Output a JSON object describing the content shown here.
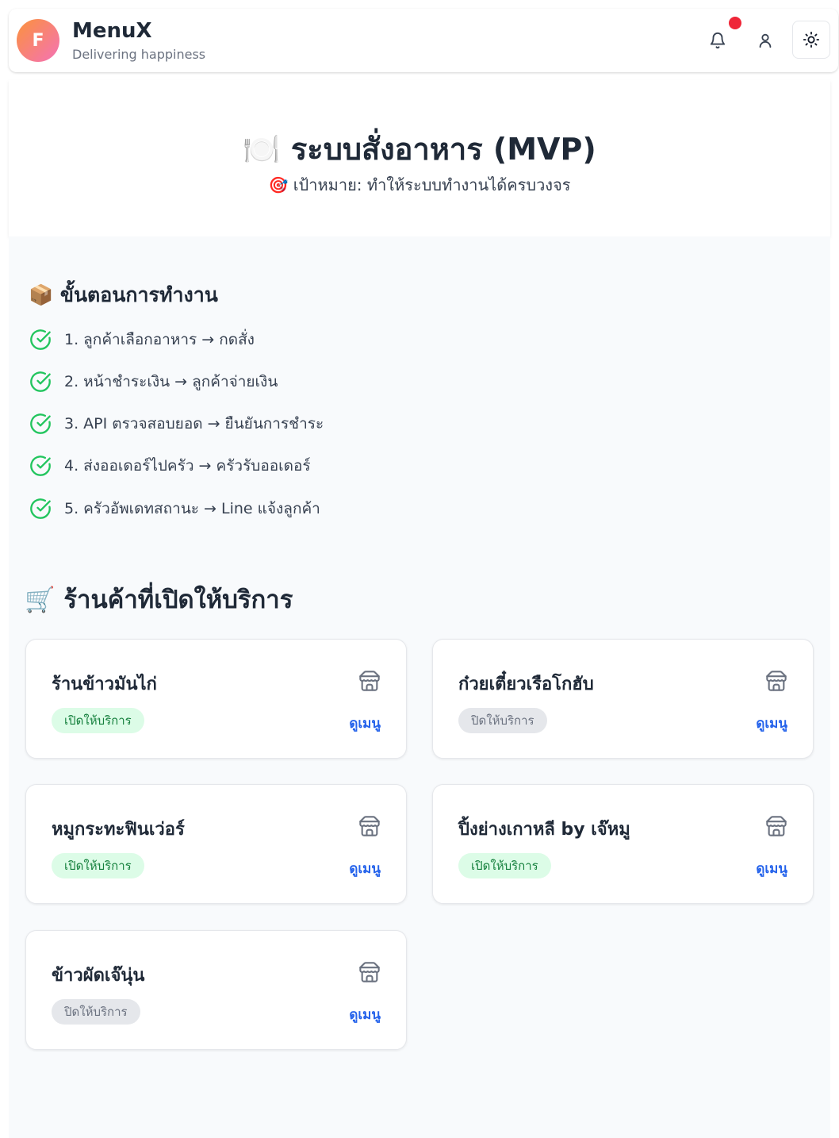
{
  "header": {
    "avatar_letter": "F",
    "title": "MenuX",
    "subtitle": "Delivering happiness",
    "icons": [
      "bell-icon",
      "user-icon",
      "sun-icon"
    ],
    "notification_dot_color": "#ef2638"
  },
  "hero": {
    "title_emoji": "🍽️",
    "title": "ระบบสั่งอาหาร (MVP)",
    "subtitle_emoji": "🎯",
    "subtitle": "เป้าหมาย: ทำให้ระบบทำงานได้ครบวงจร"
  },
  "steps": {
    "heading_emoji": "📦",
    "heading": "ขั้นตอนการทำงาน",
    "items": [
      "1. ลูกค้าเลือกอาหาร → กดสั่ง",
      "2. หน้าชำระเงิน → ลูกค้าจ่ายเงิน",
      "3. API ตรวจสอบยอด → ยืนยันการชำระ",
      "4. ส่งออเดอร์ไปครัว → ครัวรับออเดอร์",
      "5. ครัวอัพเดทสถานะ → Line แจ้งลูกค้า"
    ]
  },
  "stores": {
    "heading_emoji": "🛒",
    "heading": "ร้านค้าที่เปิดให้บริการ",
    "menu_label": "ดูเมนู",
    "items": [
      {
        "name": "ร้านข้าวมันไก่",
        "status": "เปิดให้บริการ",
        "open": true
      },
      {
        "name": "ก๋วยเตี๋ยวเรือโกฮับ",
        "status": "ปิดให้บริการ",
        "open": false
      },
      {
        "name": "หมูกระทะฟินเว่อร์",
        "status": "เปิดให้บริการ",
        "open": true
      },
      {
        "name": "ปิ้งย่างเกาหลี by เจ๊หมู",
        "status": "เปิดให้บริการ",
        "open": true
      },
      {
        "name": "ข้าวผัดเจ๊นุ่น",
        "status": "ปิดให้บริการ",
        "open": false
      }
    ]
  },
  "colors": {
    "accent_link": "#2563eb",
    "open_badge_bg": "#dcfce7",
    "open_badge_text": "#15803d",
    "closed_badge_bg": "#e5e7eb",
    "check_green": "#22c55e"
  }
}
